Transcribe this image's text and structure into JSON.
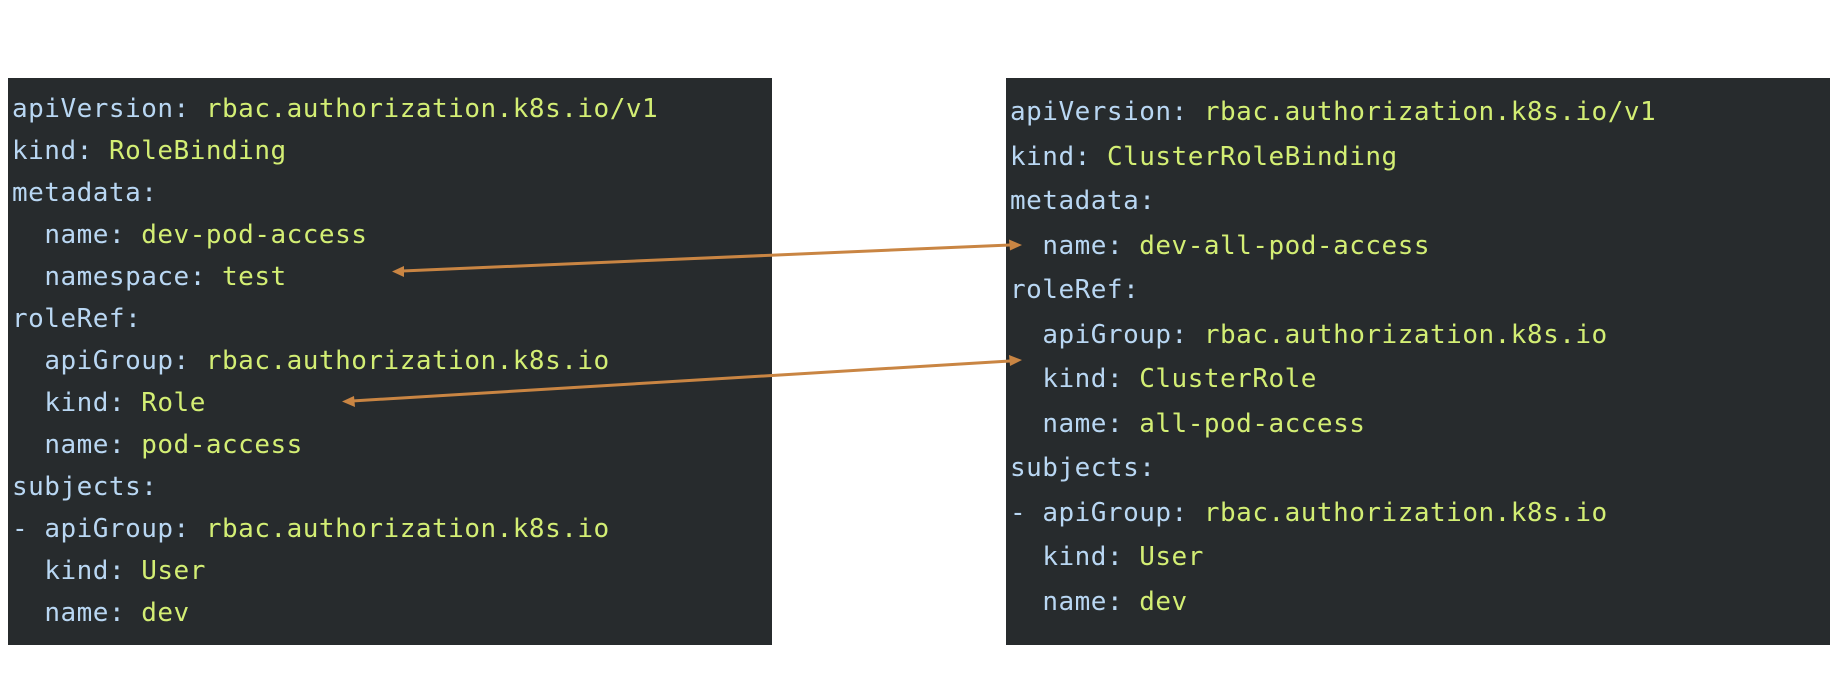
{
  "left_yaml": {
    "lines": [
      {
        "indent": "",
        "key": "apiVersion",
        "value": "rbac.authorization.k8s.io/v1"
      },
      {
        "indent": "",
        "key": "kind",
        "value": "RoleBinding"
      },
      {
        "indent": "",
        "key": "metadata",
        "value": ""
      },
      {
        "indent": "  ",
        "key": "name",
        "value": "dev-pod-access"
      },
      {
        "indent": "  ",
        "key": "namespace",
        "value": "test"
      },
      {
        "indent": "",
        "key": "roleRef",
        "value": ""
      },
      {
        "indent": "  ",
        "key": "apiGroup",
        "value": "rbac.authorization.k8s.io"
      },
      {
        "indent": "  ",
        "key": "kind",
        "value": "Role"
      },
      {
        "indent": "  ",
        "key": "name",
        "value": "pod-access"
      },
      {
        "indent": "",
        "key": "subjects",
        "value": ""
      },
      {
        "indent": "- ",
        "key": "apiGroup",
        "value": "rbac.authorization.k8s.io"
      },
      {
        "indent": "  ",
        "key": "kind",
        "value": "User"
      },
      {
        "indent": "  ",
        "key": "name",
        "value": "dev"
      }
    ]
  },
  "right_yaml": {
    "lines": [
      {
        "indent": "",
        "key": "apiVersion",
        "value": "rbac.authorization.k8s.io/v1"
      },
      {
        "indent": "",
        "key": "kind",
        "value": "ClusterRoleBinding"
      },
      {
        "indent": "",
        "key": "metadata",
        "value": ""
      },
      {
        "indent": "  ",
        "key": "name",
        "value": "dev-all-pod-access"
      },
      {
        "indent": "",
        "key": "roleRef",
        "value": ""
      },
      {
        "indent": "  ",
        "key": "apiGroup",
        "value": "rbac.authorization.k8s.io"
      },
      {
        "indent": "  ",
        "key": "kind",
        "value": "ClusterRole"
      },
      {
        "indent": "  ",
        "key": "name",
        "value": "all-pod-access"
      },
      {
        "indent": "",
        "key": "subjects",
        "value": ""
      },
      {
        "indent": "- ",
        "key": "apiGroup",
        "value": "rbac.authorization.k8s.io"
      },
      {
        "indent": "  ",
        "key": "kind",
        "value": "User"
      },
      {
        "indent": "  ",
        "key": "name",
        "value": "dev"
      }
    ]
  },
  "colors": {
    "panel_background": "#272b2d",
    "key_color": "#b9d7f3",
    "value_color": "#d3ee74",
    "arrow_color": "#c98543"
  }
}
